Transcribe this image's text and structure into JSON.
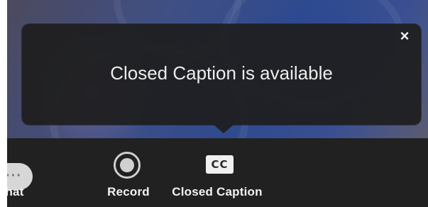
{
  "tooltip": {
    "message": "Closed Caption is available",
    "close_icon": "close-icon"
  },
  "toolbar": {
    "items": [
      {
        "label": "Chat",
        "icon": "chat-icon"
      },
      {
        "label": "Record",
        "icon": "record-icon"
      },
      {
        "label": "Closed Caption",
        "icon": "closed-caption-icon",
        "icon_text": "CC"
      }
    ]
  },
  "colors": {
    "toolbar_bg": "#212121",
    "tooltip_bg": "#1e1e1e",
    "icon_fill": "#d7d7d7"
  }
}
